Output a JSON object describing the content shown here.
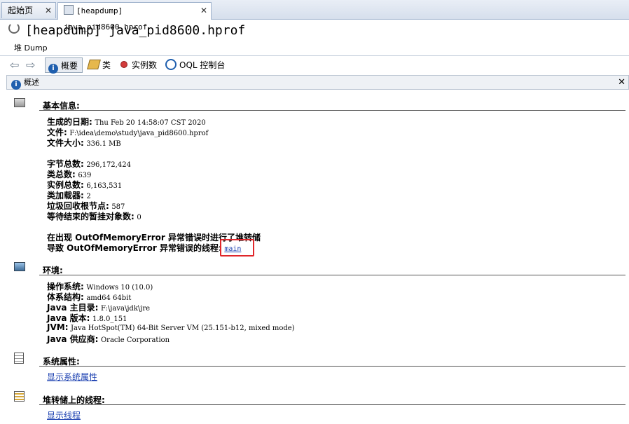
{
  "tabs": [
    {
      "label": "起始页"
    },
    {
      "label": "[heapdump] java_pid8600.hprof"
    }
  ],
  "title": "[heapdump] java_pid8600.hprof",
  "subtab": "堆 Dump",
  "toolbar": {
    "summary": "概要",
    "classes": "类",
    "instances": "实例数",
    "oql": "OQL 控制台"
  },
  "overview": {
    "label": "概述"
  },
  "basic": {
    "title": "基本信息:",
    "date_label": "生成的日期:",
    "date_value": "Thu Feb 20 14:58:07 CST 2020",
    "file_label": "文件:",
    "file_value": "F:\\idea\\demo\\study\\java_pid8600.hprof",
    "size_label": "文件大小:",
    "size_value": "336.1 MB",
    "bytes_label": "字节总数:",
    "bytes_value": "296,172,424",
    "classes_label": "类总数:",
    "classes_value": "639",
    "instances_label": "实例总数:",
    "instances_value": "6,163,531",
    "loaders_label": "类加载器:",
    "loaders_value": "2",
    "gcroots_label": "垃圾回收根节点:",
    "gcroots_value": "587",
    "finalize_label": "等待结束的暂挂对象数:",
    "finalize_value": "0",
    "oom_line": "在出现 OutOfMemoryError 异常错误时进行了堆转储",
    "oom_thread_label": "导致 OutOfMemoryError 异常错误的线程:",
    "oom_thread_link": "main"
  },
  "env": {
    "title": "环境:",
    "os_label": "操作系统:",
    "os_value": "Windows 10 (10.0)",
    "arch_label": "体系结构:",
    "arch_value": "amd64 64bit",
    "home_label": "Java 主目录:",
    "home_value": "F:\\java\\jdk\\jre",
    "ver_label": "Java 版本:",
    "ver_value": "1.8.0_151",
    "jvm_label": "JVM:",
    "jvm_value": "Java HotSpot(TM) 64-Bit Server VM (25.151-b12, mixed mode)",
    "vendor_label": "Java 供应商:",
    "vendor_value": "Oracle Corporation"
  },
  "sysprops": {
    "title": "系统属性:",
    "link": "显示系统属性"
  },
  "threads": {
    "title": "堆转储上的线程:",
    "link": "显示线程"
  }
}
